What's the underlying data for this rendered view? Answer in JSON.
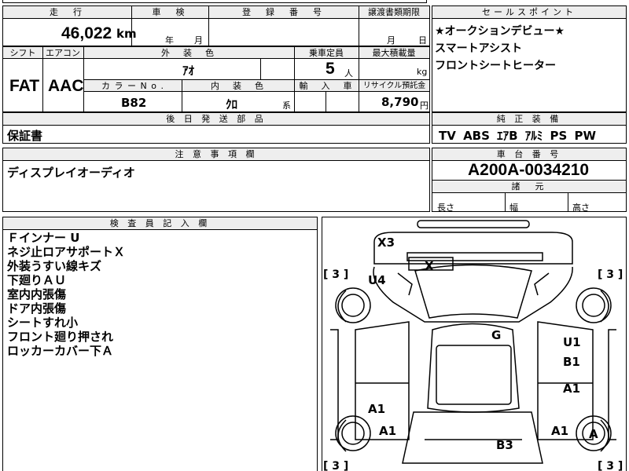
{
  "top": {
    "headers": {
      "mileage": "走　行",
      "inspection": "車　検",
      "registration": "登　録　番　号",
      "transfer_deadline": "譲渡書類期限"
    },
    "mileage": "46,022",
    "mileage_unit": "km",
    "inspection_year_unit": "年",
    "inspection_month_unit": "月",
    "deadline_month_unit": "月",
    "deadline_day_unit": "日"
  },
  "sales_points": {
    "header": "セールスポイント",
    "items": [
      "★オークションデビュー★",
      "スマートアシスト",
      "フロントシートヒーター"
    ]
  },
  "spec": {
    "shift_header": "シフト",
    "ac_header": "エアコン",
    "exterior_color_header": "外　装　色",
    "capacity_header": "乗車定員",
    "max_load_header": "最大積載量",
    "color_no_header": "カ ラ ー N o .",
    "interior_color_header": "内　装　色",
    "import_header": "輸　入　車",
    "recycle_header": "リサイクル預託金",
    "shift": "FAT",
    "ac": "AAC",
    "exterior_color": "ｱｵ",
    "capacity": "5",
    "capacity_unit": "人",
    "max_load_unit": "kg",
    "color_no": "B82",
    "interior_color": "ｸﾛ",
    "interior_color_suffix": "系",
    "recycle_fee": "8,790",
    "recycle_unit": "円"
  },
  "later_parts": {
    "header": "後 日 発 送 部 品",
    "value": "保証書"
  },
  "genuine_equipment": {
    "header": "純 正 装 備",
    "value": "TV ABS ｴｱB ｱﾙﾐ PS PW"
  },
  "notes": {
    "header": "注 意 事 項 欄",
    "value": "ディスプレイオーディオ"
  },
  "chassis": {
    "header": "車 台 番 号",
    "value": "A200A-0034210"
  },
  "dimensions": {
    "header": "諸　元",
    "length_label": "長さ",
    "width_label": "幅",
    "height_label": "高さ"
  },
  "inspector": {
    "header": "検 査 員 記 入 欄",
    "items": [
      "Ｆインナー U",
      "ネジ止ロアサポートＸ",
      "外装うすい線キズ",
      "下廻りＡＵ",
      "室内内張傷",
      "ドア内張傷",
      "シートすれ小",
      "フロント廻り押され",
      "ロッカーカバー下Ａ"
    ]
  },
  "diagram": {
    "marks": {
      "x3": "X3",
      "x": "X",
      "u4": "U4",
      "g": "G",
      "u1": "U1",
      "b1": "B1",
      "a1_right_upper": "A1",
      "a1_left_upper": "A1",
      "a1_left_lower": "A1",
      "a1_right_lower": "A1",
      "a_tire": "A",
      "b3": "B3"
    },
    "tire_labels": {
      "front_left": "[ 3 ]",
      "front_right": "[ 3 ]",
      "rear_left": "[ 3 ]",
      "rear_right": "[ 3 ]"
    }
  }
}
